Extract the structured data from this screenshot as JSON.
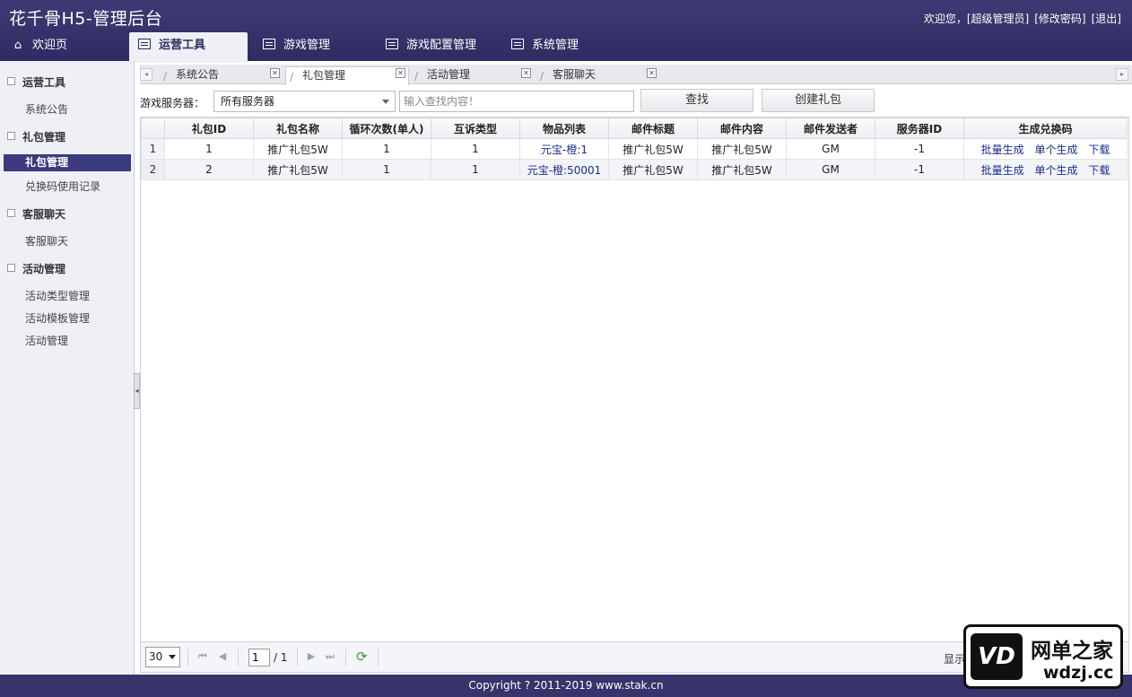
{
  "app": {
    "title": "花千骨H5-管理后台"
  },
  "user_links": {
    "welcome": "欢迎您，[超级管理员]",
    "change_password": "[修改密码]",
    "logout": "[退出]"
  },
  "main_tabs": [
    {
      "label": "欢迎页",
      "icon": "home-icon"
    },
    {
      "label": "运营工具",
      "icon": "list-icon",
      "active": true
    },
    {
      "label": "游戏管理",
      "icon": "list-icon"
    },
    {
      "label": "游戏配置管理",
      "icon": "list-icon"
    },
    {
      "label": "系统管理",
      "icon": "list-icon"
    }
  ],
  "sidebar": {
    "groups": [
      {
        "label": "运营工具",
        "items": [
          {
            "label": "系统公告"
          }
        ]
      },
      {
        "label": "礼包管理",
        "items": [
          {
            "label": "礼包管理",
            "active": true
          },
          {
            "label": "兑换码使用记录"
          }
        ]
      },
      {
        "label": "客服聊天",
        "items": [
          {
            "label": "客服聊天"
          }
        ]
      },
      {
        "label": "活动管理",
        "items": [
          {
            "label": "活动类型管理"
          },
          {
            "label": "活动模板管理"
          },
          {
            "label": "活动管理"
          }
        ]
      }
    ]
  },
  "content_tabs": [
    {
      "label": "系统公告"
    },
    {
      "label": "礼包管理",
      "active": true
    },
    {
      "label": "活动管理"
    },
    {
      "label": "客服聊天"
    }
  ],
  "toolbar": {
    "server_label": "游戏服务器：",
    "server_value": "所有服务器",
    "search_placeholder": "输入查找内容！",
    "search_button": "查找",
    "create_button": "创建礼包"
  },
  "table": {
    "columns": [
      "礼包ID",
      "礼包名称",
      "循环次数(单人)",
      "互诉类型",
      "物品列表",
      "邮件标题",
      "邮件内容",
      "邮件发送者",
      "服务器ID",
      "生成兑换码"
    ],
    "rows": [
      {
        "rn": "1",
        "id": "1",
        "name": "推广礼包5W",
        "loops": "1",
        "type": "1",
        "items": "元宝-橙:1",
        "mail_title": "推广礼包5W",
        "mail_content": "推广礼包5W",
        "sender": "GM",
        "server_id": "-1"
      },
      {
        "rn": "2",
        "id": "2",
        "name": "推广礼包5W",
        "loops": "1",
        "type": "1",
        "items": "元宝-橙:50001",
        "mail_title": "推广礼包5W",
        "mail_content": "推广礼包5W",
        "sender": "GM",
        "server_id": "-1"
      }
    ],
    "row_actions": {
      "batch": "批量生成",
      "single": "单个生成",
      "download": "下载"
    }
  },
  "pager": {
    "page_size": "30",
    "current_page": "1",
    "total": "/ 1",
    "display_info": "显示"
  },
  "footer": {
    "copyright": "Copyright ? 2011-2019 www.stak.cn"
  },
  "badge": {
    "name": "网单之家",
    "url": "wdzj.cc"
  },
  "colors": {
    "header": "#2f2b63",
    "active_item": "#3b3a7d",
    "link": "#1a2d8c"
  }
}
